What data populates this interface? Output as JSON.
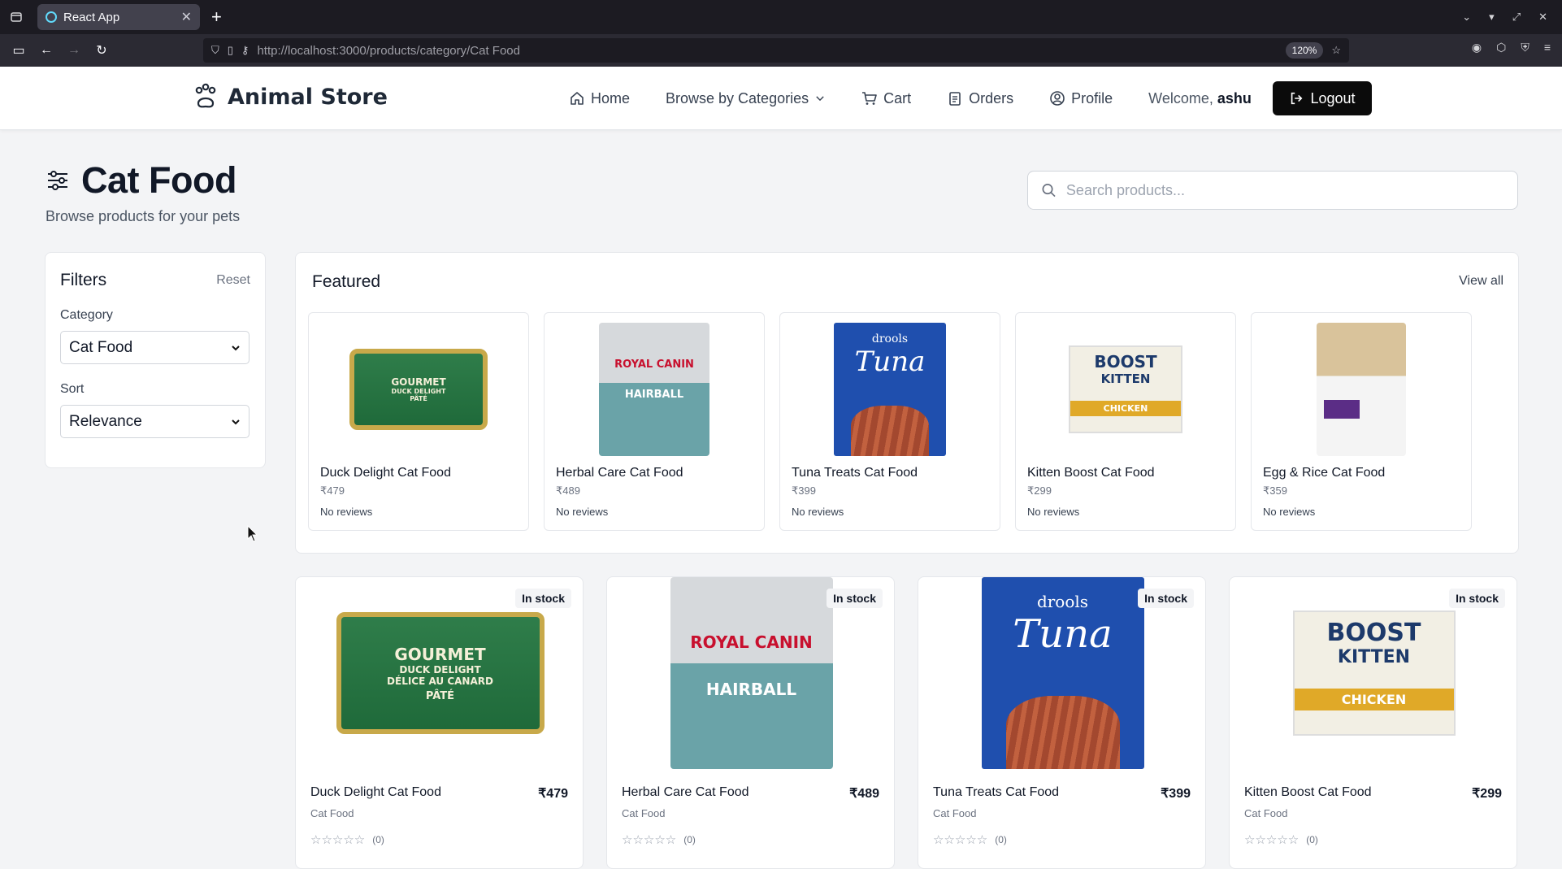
{
  "browser": {
    "tab_title": "React App",
    "url_host": "http://localhost",
    "url_path": ":3000/products/category/Cat Food",
    "zoom": "120%"
  },
  "header": {
    "brand": "Animal Store",
    "nav": {
      "home": "Home",
      "categories": "Browse by Categories",
      "cart": "Cart",
      "orders": "Orders",
      "profile": "Profile"
    },
    "welcome_prefix": "Welcome,",
    "username": "ashu",
    "logout": "Logout"
  },
  "page": {
    "title": "Cat Food",
    "subtitle": "Browse products for your pets"
  },
  "search": {
    "placeholder": "Search products..."
  },
  "filters": {
    "title": "Filters",
    "reset": "Reset",
    "category_label": "Category",
    "category_value": "Cat Food",
    "sort_label": "Sort",
    "sort_value": "Relevance"
  },
  "featured": {
    "title": "Featured",
    "view_all": "View all",
    "items": [
      {
        "name": "Duck Delight Cat Food",
        "price": "₹479",
        "reviews": "No reviews"
      },
      {
        "name": "Herbal Care Cat Food",
        "price": "₹489",
        "reviews": "No reviews"
      },
      {
        "name": "Tuna Treats Cat Food",
        "price": "₹399",
        "reviews": "No reviews"
      },
      {
        "name": "Kitten Boost Cat Food",
        "price": "₹299",
        "reviews": "No reviews"
      },
      {
        "name": "Egg & Rice Cat Food",
        "price": "₹359",
        "reviews": "No reviews"
      }
    ]
  },
  "products": [
    {
      "name": "Duck Delight Cat Food",
      "price": "₹479",
      "category": "Cat Food",
      "stock": "In stock",
      "rating_count": "(0)",
      "stars": "☆☆☆☆☆"
    },
    {
      "name": "Herbal Care Cat Food",
      "price": "₹489",
      "category": "Cat Food",
      "stock": "In stock",
      "rating_count": "(0)",
      "stars": "☆☆☆☆☆"
    },
    {
      "name": "Tuna Treats Cat Food",
      "price": "₹399",
      "category": "Cat Food",
      "stock": "In stock",
      "rating_count": "(0)",
      "stars": "☆☆☆☆☆"
    },
    {
      "name": "Kitten Boost Cat Food",
      "price": "₹299",
      "category": "Cat Food",
      "stock": "In stock",
      "rating_count": "(0)",
      "stars": "☆☆☆☆☆"
    }
  ],
  "art_text": {
    "gourmet": "GOURMET",
    "duck": "DUCK DELIGHT",
    "canard": "DÉLICE AU CANARD",
    "pate": "PÂTÉ",
    "royal": "ROYAL CANIN",
    "hairball": "HAIRBALL",
    "drools": "drools",
    "tuna": "Tuna",
    "boost": "BOOST",
    "kitten": "KITTEN",
    "chicken": "CHICKEN"
  }
}
